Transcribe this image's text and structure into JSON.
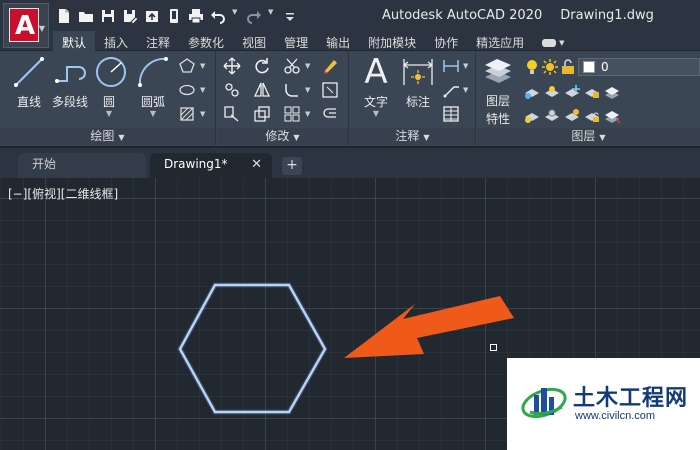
{
  "window": {
    "app_name": "Autodesk AutoCAD 2020",
    "document_name": "Drawing1.dwg"
  },
  "app_button": {
    "logo_letter": "A"
  },
  "quick_access": [
    {
      "icon": "new-file-icon"
    },
    {
      "icon": "open-folder-icon"
    },
    {
      "icon": "save-icon"
    },
    {
      "icon": "save-as-icon"
    },
    {
      "icon": "open-web-icon"
    },
    {
      "icon": "save-web-icon"
    },
    {
      "icon": "plot-printer-icon"
    },
    {
      "icon": "undo-icon"
    },
    {
      "icon": "redo-icon"
    },
    {
      "icon": "customize-dropdown-icon"
    }
  ],
  "ribbon_tabs": [
    "默认",
    "插入",
    "注释",
    "参数化",
    "视图",
    "管理",
    "输出",
    "附加模块",
    "协作",
    "精选应用"
  ],
  "active_tab": "默认",
  "panels": {
    "draw": {
      "title": "绘图",
      "tools": [
        "直线",
        "多段线",
        "圆",
        "圆弧"
      ]
    },
    "modify": {
      "title": "修改"
    },
    "annotation": {
      "title": "注释",
      "tools": [
        "文字",
        "标注"
      ]
    },
    "layers": {
      "title": "图层",
      "tool_line1": "图层",
      "tool_line2": "特性",
      "current_layer": "0"
    }
  },
  "file_tabs": {
    "start": "开始",
    "drawing": "Drawing1*",
    "close_glyph": "✕",
    "new_glyph": "+"
  },
  "viewport": {
    "controls_label": "[−][俯视][二维线框]"
  },
  "drawing": {
    "shape": "hexagon",
    "shape_color": "#b8d4ff",
    "arrow_color": "#ef5a1a"
  },
  "watermark": {
    "site_name": "土木工程网",
    "site_url": "www.civilcn.com"
  }
}
